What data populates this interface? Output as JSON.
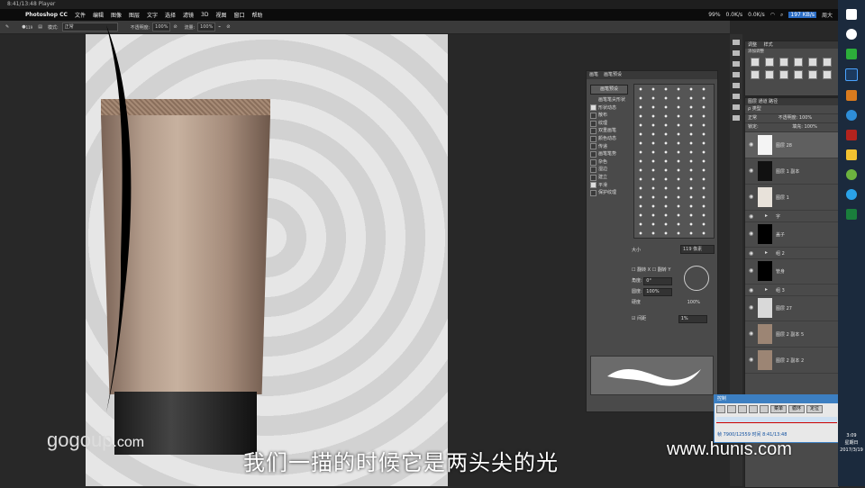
{
  "window": {
    "title": "8:41/13:48 Player"
  },
  "menubar": {
    "app": "Photoshop CC",
    "items": [
      "文件",
      "编辑",
      "图像",
      "图层",
      "文字",
      "选择",
      "滤镜",
      "3D",
      "视图",
      "窗口",
      "帮助"
    ],
    "battery": "99%",
    "net_up": "0.0K/s",
    "net_down": "0.0K/s",
    "user": "周大",
    "speed": "197 KB/s"
  },
  "options": {
    "mode_label": "模式:",
    "mode_value": "正常",
    "opacity_label": "不透明度:",
    "opacity_value": "100%",
    "flow_label": "流量:",
    "flow_value": "100%",
    "brush_size": "119"
  },
  "subtitle": "我们一描的时候它是两头尖的光",
  "watermark_left": {
    "main": "gogoup",
    "suffix": ".com"
  },
  "watermark_right": "www.hunis.com",
  "brush_panel": {
    "tab1": "画笔",
    "tab2": "画笔预设",
    "preset_button": "画笔预设",
    "options": [
      {
        "label": "画笔笔尖形状",
        "checked": false
      },
      {
        "label": "形状动态",
        "checked": true
      },
      {
        "label": "散布",
        "checked": false
      },
      {
        "label": "纹理",
        "checked": false
      },
      {
        "label": "双重画笔",
        "checked": false
      },
      {
        "label": "颜色动态",
        "checked": false
      },
      {
        "label": "传递",
        "checked": false
      },
      {
        "label": "画笔笔势",
        "checked": false
      },
      {
        "label": "杂色",
        "checked": false
      },
      {
        "label": "湿边",
        "checked": false
      },
      {
        "label": "建立",
        "checked": false
      },
      {
        "label": "平滑",
        "checked": true
      },
      {
        "label": "保护纹理",
        "checked": false
      }
    ],
    "size_label": "大小",
    "size_value": "119 像素",
    "flip_x": "翻转 X",
    "flip_y": "翻转 Y",
    "angle_label": "角度:",
    "angle_value": "0°",
    "roundness_label": "圆度:",
    "roundness_value": "100%",
    "hardness_label": "硬度",
    "hardness_value": "100%",
    "spacing_label": "间距",
    "spacing_value": "1%"
  },
  "adjust_panel": {
    "tab1": "调整",
    "tab2": "样式",
    "add_label": "添加调整"
  },
  "layers_panel": {
    "tabs": "图层  通道  路径",
    "kind": "类型",
    "blend": "正常",
    "opacity": "不透明度: 100%",
    "lock": "锁定:",
    "fill": "填充: 100%",
    "layers": [
      {
        "name": "图层 28",
        "selected": true,
        "thumb": "#f4f4f4",
        "small": false
      },
      {
        "name": "图层 1 副本",
        "selected": false,
        "thumb": "#111111",
        "small": false
      },
      {
        "name": "图层 1",
        "selected": false,
        "thumb": "#e8e2da",
        "small": false
      },
      {
        "name": "字",
        "selected": false,
        "thumb": "",
        "small": true
      },
      {
        "name": "盖子",
        "selected": false,
        "thumb": "#000000",
        "small": false
      },
      {
        "name": "组 2",
        "selected": false,
        "thumb": "",
        "small": true
      },
      {
        "name": "管身",
        "selected": false,
        "thumb": "#000000",
        "small": false
      },
      {
        "name": "组 3",
        "selected": false,
        "thumb": "",
        "small": true
      },
      {
        "name": "图层 27",
        "selected": false,
        "thumb": "#d9d9d9",
        "small": false
      },
      {
        "name": "图层 2 副本 5",
        "selected": false,
        "thumb": "#9c8574",
        "small": false
      },
      {
        "name": "图层 2 副本 2",
        "selected": false,
        "thumb": "#9c8574",
        "small": false
      }
    ]
  },
  "control_widget": {
    "title": "控制",
    "btn_menu": "菜单",
    "btn_loop": "循环",
    "btn_locate": "定位",
    "status": "帧 7900/12559 时间 8:41/13:48"
  },
  "taskbar": {
    "time": "3:09",
    "day": "星期日",
    "date": "2017/3/19"
  },
  "colors": {
    "accent": "#3c7fc2",
    "panel": "#4a4a4a",
    "tube": "#b39c8b"
  }
}
